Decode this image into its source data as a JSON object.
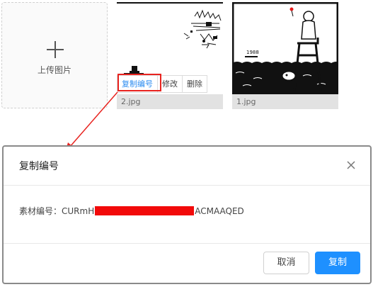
{
  "upload": {
    "label": "上传图片"
  },
  "images": [
    {
      "filename": "2.jpg"
    },
    {
      "filename": "1.jpg",
      "sign_text": "1988"
    }
  ],
  "image_toolbar": {
    "copy_id": "复制编号",
    "edit": "修改",
    "delete": "删除"
  },
  "modal": {
    "title": "复制编号",
    "field_label": "素材编号：",
    "id_prefix": "CURmH",
    "id_suffix": "ACMAAQED",
    "cancel": "取消",
    "copy": "复制"
  },
  "colors": {
    "accent": "#1e90ff",
    "highlight": "#e8231f",
    "redaction": "#f20a0a"
  }
}
